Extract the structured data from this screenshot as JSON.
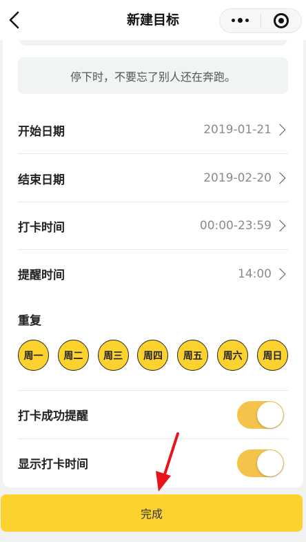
{
  "navbar": {
    "title": "新建目标",
    "back_icon": "chevron-left-icon",
    "more_icon": "more-dots-icon",
    "close_icon": "target-close-icon"
  },
  "quote": "停下时，不要忘了别人还在奔跑。",
  "fields": [
    {
      "label": "开始日期",
      "value": "2019-01-21"
    },
    {
      "label": "结束日期",
      "value": "2019-02-20"
    },
    {
      "label": "打卡时间",
      "value": "00:00-23:59"
    },
    {
      "label": "提醒时间",
      "value": "14:00"
    }
  ],
  "repeat": {
    "label": "重复",
    "days": [
      {
        "label": "周一",
        "selected": true
      },
      {
        "label": "周二",
        "selected": true
      },
      {
        "label": "周三",
        "selected": true
      },
      {
        "label": "周四",
        "selected": true
      },
      {
        "label": "周五",
        "selected": true
      },
      {
        "label": "周六",
        "selected": true
      },
      {
        "label": "周日",
        "selected": true
      }
    ]
  },
  "toggles": [
    {
      "label": "打卡成功提醒",
      "on": true
    },
    {
      "label": "显示打卡时间",
      "on": true
    }
  ],
  "done_label": "完成",
  "colors": {
    "accent": "#fcd22f",
    "toggle_on": "#f5c24a",
    "annotation_arrow": "#e8141c"
  }
}
